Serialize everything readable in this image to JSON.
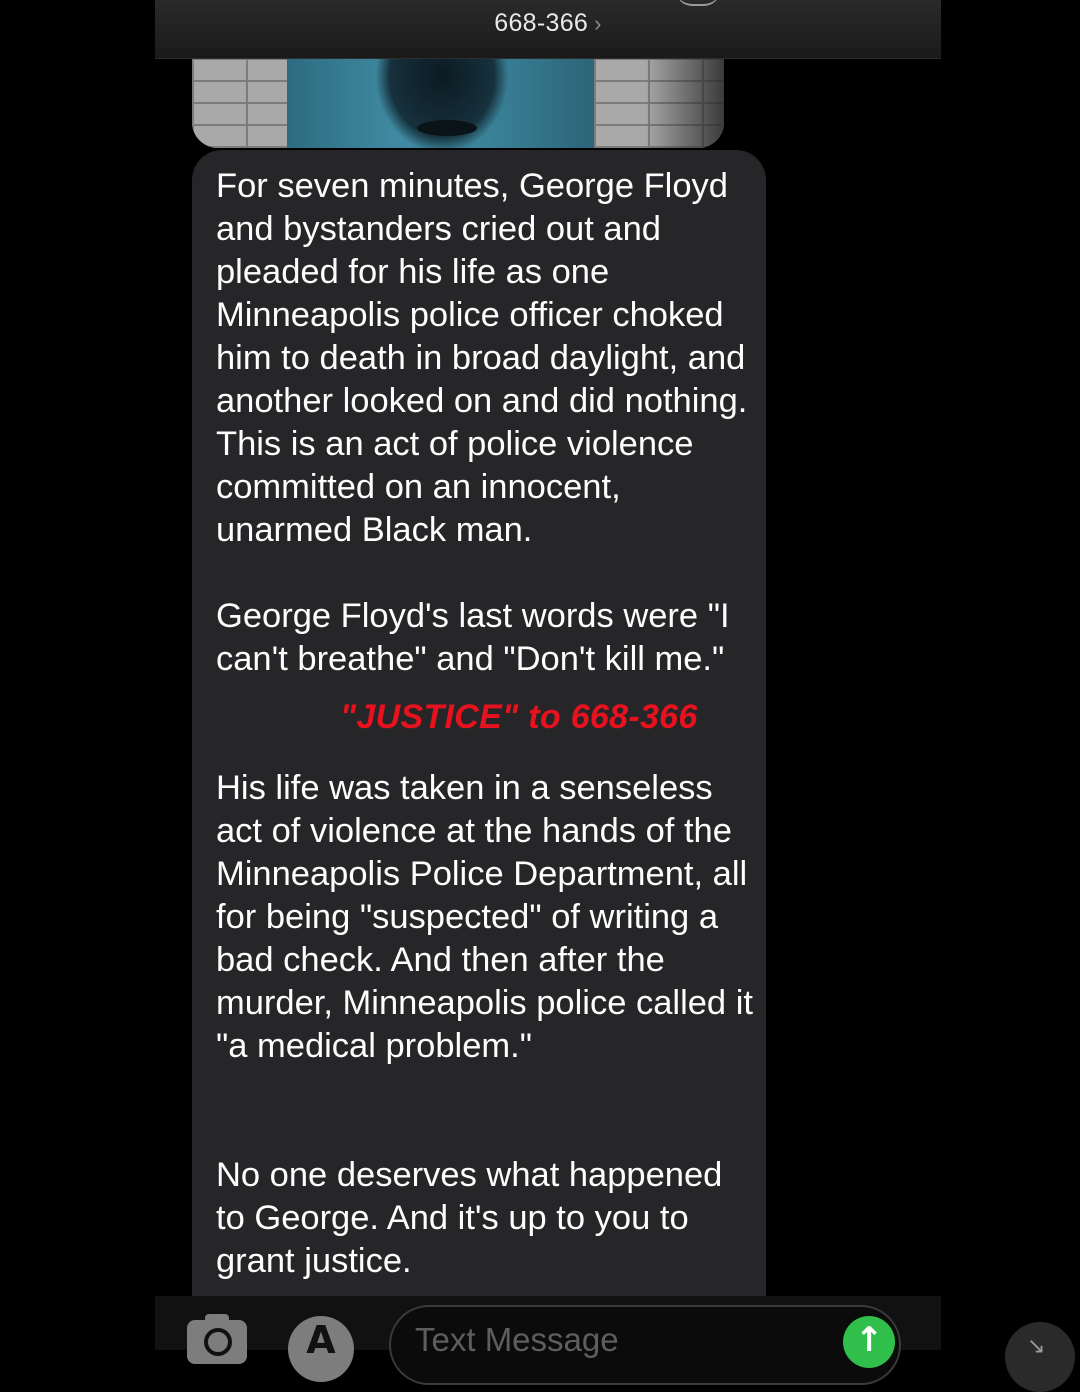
{
  "header": {
    "contact_name": "668-366",
    "chevron": "›"
  },
  "image_message": {
    "type": "photo",
    "icon": "photo-attachment"
  },
  "message": {
    "paragraphs": [
      "For seven minutes, George Floyd and bystanders cried out and pleaded for his life as one Minneapolis police officer choked him to death in broad daylight, and another looked on and did nothing. This is an act of police violence committed on an innocent, unarmed Black man.",
      "George Floyd's last words were \"I can't breathe\" and \"Don't kill me.\"",
      "His life was taken in a senseless act of violence at the hands of the Minneapolis Police Department, all for being \"suspected\" of writing a bad check. And then after the murder, Minneapolis police called it \"a medical problem.\"",
      "No one deserves what happened to George. And it's up to you to grant justice."
    ]
  },
  "overlay": {
    "caption": "\"JUSTICE\" to 668-366",
    "caption_color": "#e8121f"
  },
  "input_bar": {
    "camera_icon": "camera-icon",
    "appstore_icon": "app-store-icon",
    "appstore_glyph": "A",
    "placeholder": "Text Message",
    "send_glyph": "↑",
    "send_color": "#2fbf4a"
  },
  "corner_button": {
    "glyph": "↘"
  }
}
